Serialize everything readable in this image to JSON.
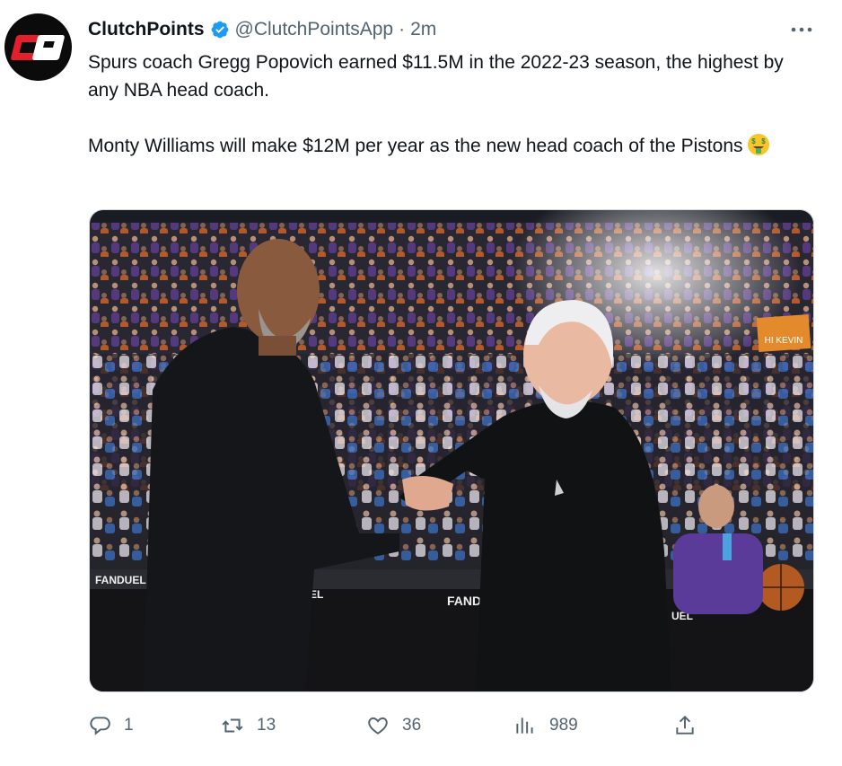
{
  "author": {
    "name": "ClutchPoints",
    "handle": "@ClutchPointsApp",
    "separator": "·",
    "time": "2m",
    "avatar_icon": "clutchpoints-logo",
    "verified_icon": "verified-badge-icon",
    "accent": "#1d9bf0"
  },
  "tweet": {
    "line1": "Spurs coach Gregg Popovich earned $11.5M in the 2022-23 season, the highest by any NBA head coach.",
    "line2": "Monty Williams will make $12M per year as the new head coach of the Pistons",
    "emoji": "money-mouth-face"
  },
  "media": {
    "signs": {
      "fanduel_left": "FANDUEL",
      "fanduel_center": "FANDU",
      "el_mid": "EL",
      "el_right": "UEL",
      "crowd_sign": "HI KEVIN"
    }
  },
  "actions": {
    "reply": {
      "icon": "reply-icon",
      "count": "1"
    },
    "retweet": {
      "icon": "retweet-icon",
      "count": "13"
    },
    "like": {
      "icon": "like-icon",
      "count": "36"
    },
    "views": {
      "icon": "views-icon",
      "count": "989"
    },
    "share": {
      "icon": "share-icon"
    }
  },
  "more_icon": "more-options-icon"
}
